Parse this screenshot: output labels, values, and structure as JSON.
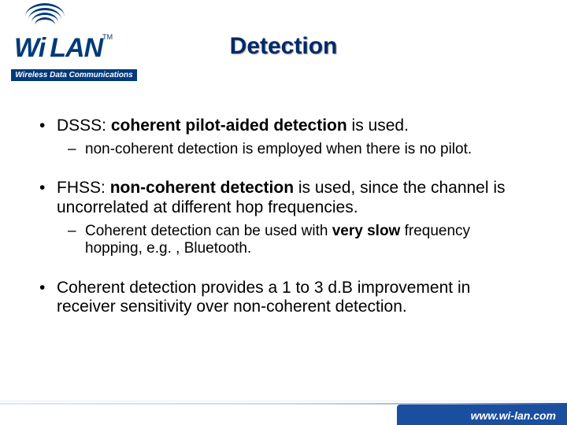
{
  "logo": {
    "brand_part1": "Wi",
    "brand_part2": "LAN",
    "tm": "TM",
    "subtitle": "Wireless Data Communications"
  },
  "title": "Detection",
  "bullets": {
    "b1_pre": "DSSS: ",
    "b1_bold": "coherent pilot-aided detection",
    "b1_post": " is used.",
    "b1_sub": "non-coherent detection is employed when there is no pilot.",
    "b2_pre": "FHSS: ",
    "b2_bold": "non-coherent detection",
    "b2_post": " is used, since the channel is uncorrelated at different hop frequencies.",
    "b2_sub_pre": "Coherent detection can be used with ",
    "b2_sub_bold": "very slow",
    "b2_sub_post": " frequency hopping, e.g. , Bluetooth.",
    "b3": "Coherent detection provides a 1 to 3 d.B improvement in receiver sensitivity over non-coherent detection."
  },
  "footer": {
    "url": "www.wi-lan.com"
  }
}
